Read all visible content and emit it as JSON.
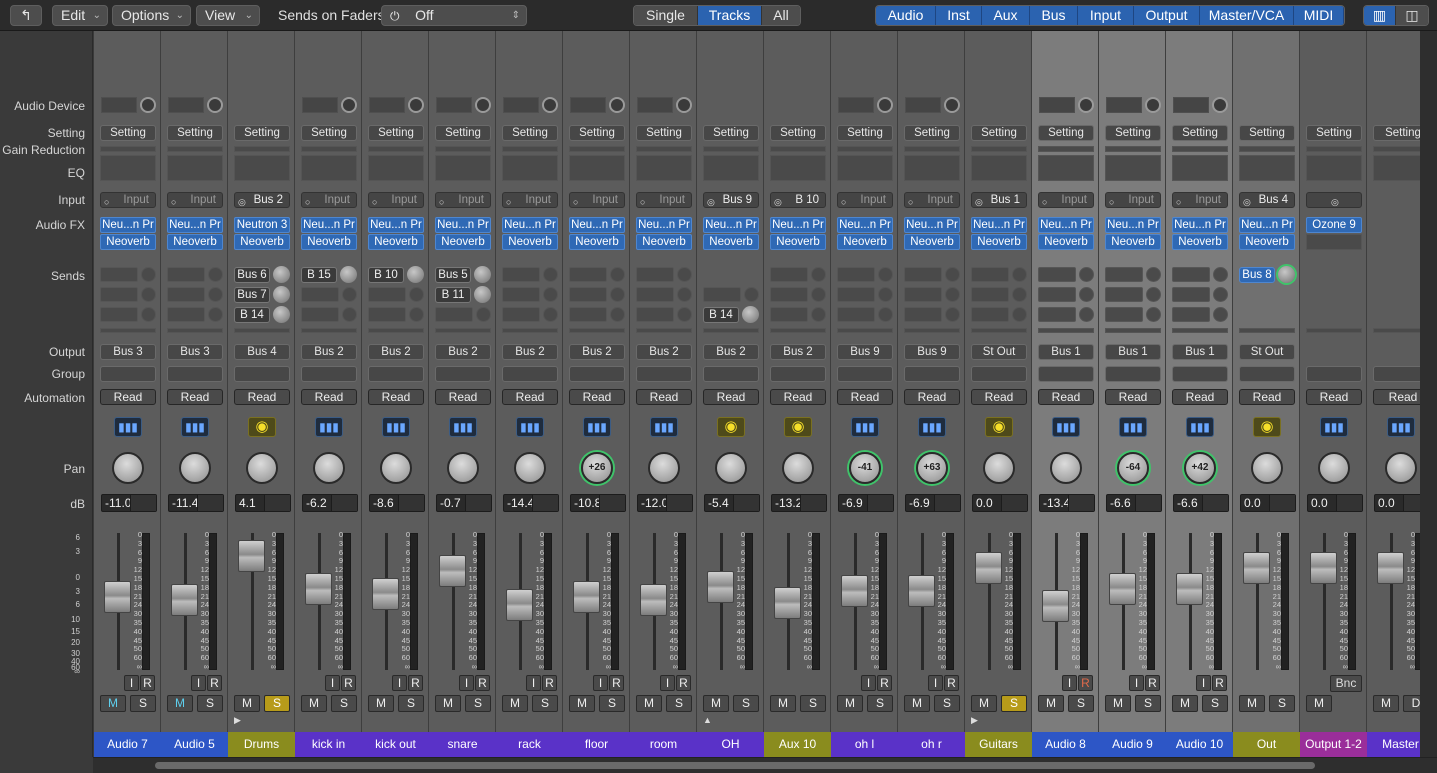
{
  "toolbar": {
    "back_icon": "back-arrow-icon",
    "menus": [
      "Edit",
      "Options",
      "View"
    ],
    "sends_on_faders_label": "Sends on Faders:",
    "sends_on_faders_value": "Off",
    "view_modes": [
      "Single",
      "Tracks",
      "All"
    ],
    "view_mode_selected": "Tracks",
    "filters": [
      "Audio",
      "Inst",
      "Aux",
      "Bus",
      "Input",
      "Output",
      "Master/VCA",
      "MIDI"
    ]
  },
  "row_labels": {
    "audio_device": "Audio Device",
    "setting": "Setting",
    "gain_reduction": "Gain Reduction",
    "eq": "EQ",
    "input": "Input",
    "audio_fx": "Audio FX",
    "sends": "Sends",
    "output": "Output",
    "group": "Group",
    "automation": "Automation",
    "pan": "Pan",
    "db": "dB"
  },
  "fader_scale": [
    "6",
    "3",
    "0",
    "3",
    "6",
    "10",
    "15",
    "20",
    "30",
    "40",
    "60",
    "∞"
  ],
  "meter_scale": [
    "0",
    "3",
    "6",
    "9",
    "12",
    "15",
    "18",
    "21",
    "24",
    "30",
    "35",
    "40",
    "45",
    "50",
    "60",
    "∞"
  ],
  "setting_label": "Setting",
  "read_label": "Read",
  "ir_labels": [
    "I",
    "R"
  ],
  "ms_labels": [
    "M",
    "S"
  ],
  "bnc_label": "Bnc",
  "strips": [
    {
      "name": "Audio 7",
      "color": "#2d56c6",
      "input": "Input",
      "input_src": false,
      "fx": [
        "Neu...n Pr",
        "Neoverb"
      ],
      "sends": [],
      "output": "Bus 3",
      "db": "-11.0",
      "pan": "",
      "mute": true,
      "solo": false,
      "auto": "wave",
      "fader": 0.48,
      "device": true
    },
    {
      "name": "Audio 5",
      "color": "#2d56c6",
      "input": "Input",
      "input_src": false,
      "fx": [
        "Neu...n Pr",
        "Neoverb"
      ],
      "sends": [],
      "output": "Bus 3",
      "db": "-11.4",
      "pan": "",
      "mute": true,
      "solo": false,
      "auto": "wave",
      "fader": 0.5,
      "device": true
    },
    {
      "name": "Drums",
      "color": "#8a8c1e",
      "input": "Bus 2",
      "input_src": true,
      "fx": [
        "Neutron 3",
        "Neoverb"
      ],
      "sends": [
        "Bus 6",
        "Bus 7",
        "B 14"
      ],
      "output": "Bus 4",
      "db": "4.1",
      "pan": "",
      "mute": false,
      "solo": true,
      "auto": "latch",
      "fader": 0.09,
      "device": false
    },
    {
      "name": "kick in",
      "color": "#5a32c8",
      "input": "Input",
      "input_src": false,
      "fx": [
        "Neu...n Pr",
        "Neoverb"
      ],
      "sends": [
        "B 15"
      ],
      "output": "Bus 2",
      "db": "-6.2",
      "pan": "",
      "mute": false,
      "solo": false,
      "auto": "wave",
      "fader": 0.4,
      "device": true
    },
    {
      "name": "kick out",
      "color": "#5a32c8",
      "input": "Input",
      "input_src": false,
      "fx": [
        "Neu...n Pr",
        "Neoverb"
      ],
      "sends": [
        "B 10"
      ],
      "output": "Bus 2",
      "db": "-8.6",
      "pan": "",
      "mute": false,
      "solo": false,
      "auto": "wave",
      "fader": 0.45,
      "device": true
    },
    {
      "name": "snare",
      "color": "#5a32c8",
      "input": "Input",
      "input_src": false,
      "fx": [
        "Neu...n Pr",
        "Neoverb"
      ],
      "sends": [
        "Bus 5",
        "B 11"
      ],
      "output": "Bus 2",
      "db": "-0.7",
      "pan": "",
      "mute": false,
      "solo": false,
      "auto": "wave",
      "fader": 0.23,
      "device": true
    },
    {
      "name": "rack",
      "color": "#5a32c8",
      "input": "Input",
      "input_src": false,
      "fx": [
        "Neu...n Pr",
        "Neoverb"
      ],
      "sends": [],
      "output": "Bus 2",
      "db": "-14.4",
      "pan": "",
      "mute": false,
      "solo": false,
      "auto": "wave",
      "fader": 0.55,
      "device": true
    },
    {
      "name": "floor",
      "color": "#5a32c8",
      "input": "Input",
      "input_src": false,
      "fx": [
        "Neu...n Pr",
        "Neoverb"
      ],
      "sends": [],
      "output": "Bus 2",
      "db": "-10.8",
      "pan": "+26",
      "mute": false,
      "solo": false,
      "auto": "wave",
      "fader": 0.48,
      "device": true
    },
    {
      "name": "room",
      "color": "#5a32c8",
      "input": "Input",
      "input_src": false,
      "fx": [
        "Neu...n Pr",
        "Neoverb"
      ],
      "sends": [],
      "output": "Bus 2",
      "db": "-12.0",
      "pan": "",
      "mute": false,
      "solo": false,
      "auto": "wave",
      "fader": 0.5,
      "device": true
    },
    {
      "name": "OH",
      "color": "#5a32c8",
      "input": "Bus 9",
      "input_src": true,
      "fx": [
        "Neu...n Pr",
        "Neoverb"
      ],
      "sends": [
        "B 14"
      ],
      "output": "Bus 2",
      "db": "-5.4",
      "pan": "",
      "mute": false,
      "solo": false,
      "auto": "latch",
      "fader": 0.38,
      "device": false
    },
    {
      "name": "Aux 10",
      "color": "#8a8c1e",
      "input": "B 10",
      "input_src": true,
      "fx": [
        "Neu...n Pr",
        "Neoverb"
      ],
      "sends": [],
      "output": "Bus 2",
      "db": "-13.2",
      "pan": "",
      "mute": false,
      "solo": false,
      "auto": "latch",
      "fader": 0.53,
      "device": false
    },
    {
      "name": "oh l",
      "color": "#5a32c8",
      "input": "Input",
      "input_src": false,
      "fx": [
        "Neu...n Pr",
        "Neoverb"
      ],
      "sends": [],
      "output": "Bus 9",
      "db": "-6.9",
      "pan": "-41",
      "mute": false,
      "solo": false,
      "auto": "wave",
      "fader": 0.42,
      "device": true
    },
    {
      "name": "oh r",
      "color": "#5a32c8",
      "input": "Input",
      "input_src": false,
      "fx": [
        "Neu...n Pr",
        "Neoverb"
      ],
      "sends": [],
      "output": "Bus 9",
      "db": "-6.9",
      "pan": "+63",
      "mute": false,
      "solo": false,
      "auto": "wave",
      "fader": 0.42,
      "device": true
    },
    {
      "name": "Guitars",
      "color": "#8a8c1e",
      "input": "Bus 1",
      "input_src": true,
      "fx": [
        "Neu...n Pr",
        "Neoverb"
      ],
      "sends": [],
      "output": "St Out",
      "db": "0.0",
      "pan": "",
      "mute": false,
      "solo": true,
      "auto": "latch",
      "fader": 0.2,
      "device": false
    },
    {
      "name": "Audio 8",
      "color": "#2d56c6",
      "input": "Input",
      "input_src": false,
      "fx": [
        "Neu...n Pr",
        "Neoverb"
      ],
      "sends": [],
      "output": "Bus 1",
      "db": "-13.4",
      "pan": "",
      "mute": false,
      "solo": false,
      "auto": "wave",
      "fader": 0.56,
      "device": true,
      "rec_on": true
    },
    {
      "name": "Audio 9",
      "color": "#2d56c6",
      "input": "Input",
      "input_src": false,
      "fx": [
        "Neu...n Pr",
        "Neoverb"
      ],
      "sends": [],
      "output": "Bus 1",
      "db": "-6.6",
      "pan": "-64",
      "mute": false,
      "solo": false,
      "auto": "wave",
      "fader": 0.4,
      "device": true
    },
    {
      "name": "Audio 10",
      "color": "#2d56c6",
      "input": "Input",
      "input_src": false,
      "fx": [
        "Neu...n Pr",
        "Neoverb"
      ],
      "sends": [],
      "output": "Bus 1",
      "db": "-6.6",
      "pan": "+42",
      "mute": false,
      "solo": false,
      "auto": "wave",
      "fader": 0.4,
      "device": true
    },
    {
      "name": "Out",
      "color": "#8a8c1e",
      "input": "Bus 4",
      "input_src": true,
      "fx": [
        "Neu...n Pr",
        "Neoverb"
      ],
      "sends": [
        "Bus 8"
      ],
      "output": "St Out",
      "db": "0.0",
      "pan": "",
      "mute": false,
      "solo": false,
      "auto": "latch",
      "fader": 0.2,
      "device": false
    },
    {
      "name": "Output 1-2",
      "color": "#9a2e9a",
      "input": "",
      "input_src": true,
      "fx": [
        "Ozone 9"
      ],
      "sends": [],
      "output": "",
      "db": "0.0",
      "pan": "",
      "mute": false,
      "solo": false,
      "auto": "wave",
      "fader": 0.2,
      "device": false,
      "bnc": true
    },
    {
      "name": "Master",
      "color": "#5a32c8",
      "input": "",
      "input_src": false,
      "fx": [],
      "sends": [],
      "output": "",
      "db": "0.0",
      "pan": "",
      "mute": false,
      "solo": false,
      "auto": "wave",
      "fader": 0.2,
      "device": false,
      "master": true
    }
  ],
  "colors": {
    "accent_blue": "#2b63b0",
    "solo_yellow": "#b79b1a",
    "mute_cyan": "#5fd0ee",
    "pan_green": "#3fc46a"
  }
}
